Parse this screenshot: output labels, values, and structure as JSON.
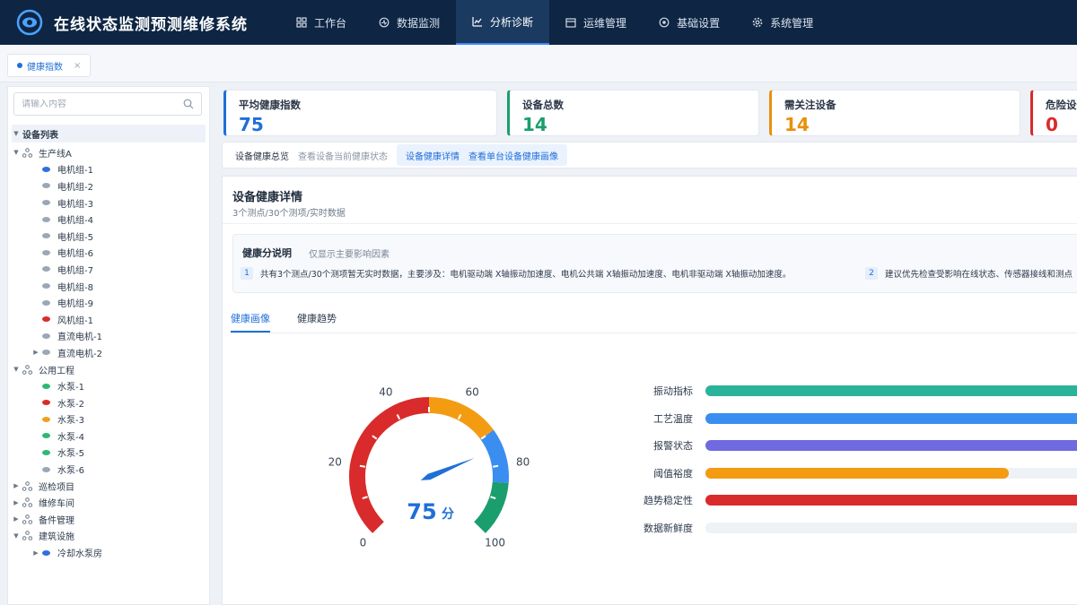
{
  "app": {
    "title": "在线状态监测预测维修系统"
  },
  "nav": [
    {
      "label": "工作台",
      "icon": "grid-icon"
    },
    {
      "label": "数据监测",
      "icon": "monitor-icon"
    },
    {
      "label": "分析诊断",
      "icon": "chart-icon",
      "active": true
    },
    {
      "label": "运维管理",
      "icon": "calendar-icon"
    },
    {
      "label": "基础设置",
      "icon": "target-icon"
    },
    {
      "label": "系统管理",
      "icon": "gear-icon"
    }
  ],
  "page_tab": {
    "label": "健康指数",
    "close": "×"
  },
  "search": {
    "placeholder": "请输入内容"
  },
  "tree": {
    "root": "设备列表",
    "groups": [
      {
        "label": "生产线A",
        "expanded": true,
        "children": [
          {
            "label": "电机组-1",
            "status": "#2f6fdf"
          },
          {
            "label": "电机组-2",
            "status": "#9aa7b6"
          },
          {
            "label": "电机组-3",
            "status": "#9aa7b6"
          },
          {
            "label": "电机组-4",
            "status": "#9aa7b6"
          },
          {
            "label": "电机组-5",
            "status": "#9aa7b6"
          },
          {
            "label": "电机组-6",
            "status": "#9aa7b6"
          },
          {
            "label": "电机组-7",
            "status": "#9aa7b6"
          },
          {
            "label": "电机组-8",
            "status": "#9aa7b6"
          },
          {
            "label": "电机组-9",
            "status": "#9aa7b6"
          },
          {
            "label": "风机组-1",
            "status": "#d92b2b"
          },
          {
            "label": "直流电机-1",
            "status": "#9aa7b6"
          },
          {
            "label": "直流电机-2",
            "status": "#9aa7b6",
            "collapsible": true
          }
        ]
      },
      {
        "label": "公用工程",
        "expanded": true,
        "children": [
          {
            "label": "水泵-1",
            "status": "#2eb872"
          },
          {
            "label": "水泵-2",
            "status": "#d92b2b"
          },
          {
            "label": "水泵-3",
            "status": "#f0a020"
          },
          {
            "label": "水泵-4",
            "status": "#2eb872"
          },
          {
            "label": "水泵-5",
            "status": "#2eb872"
          },
          {
            "label": "水泵-6",
            "status": "#9aa7b6"
          }
        ]
      },
      {
        "label": "巡检项目",
        "expanded": false,
        "children": []
      },
      {
        "label": "维修车间",
        "expanded": false,
        "children": []
      },
      {
        "label": "备件管理",
        "expanded": false,
        "children": []
      },
      {
        "label": "建筑设施",
        "expanded": true,
        "children": [
          {
            "label": "冷却水泵房",
            "status": "#2f6fdf",
            "collapsible": true
          }
        ]
      }
    ]
  },
  "cards": [
    {
      "label": "平均健康指数",
      "value": "75",
      "color": "#1f6fd8"
    },
    {
      "label": "设备总数",
      "value": "14",
      "color": "#1a9e6e"
    },
    {
      "label": "需关注设备",
      "value": "14",
      "color": "#e8900c"
    },
    {
      "label": "危险设备",
      "value": "0",
      "color": "#d92b2b"
    }
  ],
  "section_tabs": [
    {
      "label": "设备健康总览",
      "desc": "查看设备当前健康状态"
    },
    {
      "label": "设备健康详情",
      "desc": "查看单台设备健康画像",
      "active": true
    }
  ],
  "panel": {
    "title": "设备健康详情",
    "subtitle": "3个测点/30个测项/实时数据"
  },
  "explain": {
    "title": "健康分说明",
    "note": "仅显示主要影响因素",
    "items": [
      {
        "num": "1",
        "text": "共有3个测点/30个测项暂无实时数据，主要涉及：电机驱动端 X轴振动加速度、电机公共端 X轴振动加速度、电机非驱动端 X轴振动加速度。"
      },
      {
        "num": "2",
        "text": "建议优先检查受影响在线状态、传感器接线和测点"
      }
    ]
  },
  "sub_tabs": [
    {
      "label": "健康画像",
      "active": true
    },
    {
      "label": "健康趋势"
    }
  ],
  "gauge": {
    "value": 75,
    "unit": "分",
    "ticks": [
      "0",
      "20",
      "40",
      "60",
      "80",
      "100"
    ]
  },
  "factors": [
    {
      "label": "振动指标",
      "value": 1.0,
      "color": "#2bb39a"
    },
    {
      "label": "工艺温度",
      "value": 1.0,
      "color": "#3a8ef0"
    },
    {
      "label": "报警状态",
      "value": 1.0,
      "color": "#6f6ae0"
    },
    {
      "label": "阈值裕度",
      "value": 0.8,
      "color": "#f39c12"
    },
    {
      "label": "趋势稳定性",
      "value": 1.0,
      "color": "#d92b2b"
    },
    {
      "label": "数据新鲜度",
      "value": 0.0,
      "color": "#dfe6ef"
    }
  ]
}
